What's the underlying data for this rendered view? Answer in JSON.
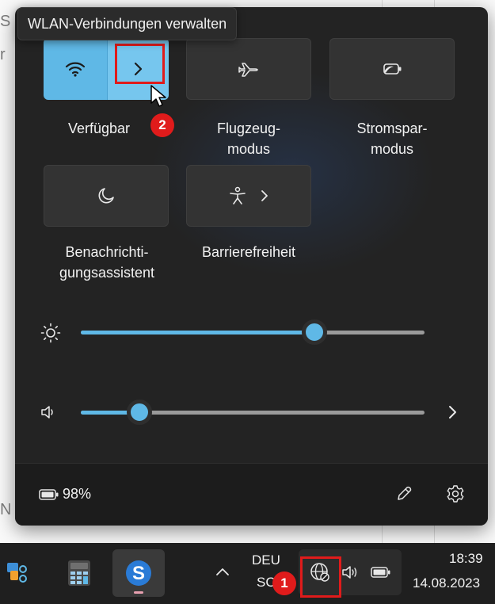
{
  "tooltip": {
    "text": "WLAN-Verbindungen verwalten"
  },
  "tiles": {
    "wifi": {
      "label": "Verfügbar",
      "icon": "wifi-icon",
      "expand_icon": "chevron-right-icon"
    },
    "airplane": {
      "label": "Flugzeug-\nmodus",
      "icon": "airplane-icon"
    },
    "battery_saver": {
      "label": "Stromspar-\nmodus",
      "icon": "battery-saver-icon"
    },
    "focus": {
      "label": "Benachrichti-\ngungsassistent",
      "icon": "moon-icon"
    },
    "accessibility": {
      "label": "Barrierefreiheit",
      "icon": "accessibility-icon",
      "expand_icon": "chevron-right-icon"
    }
  },
  "sliders": {
    "brightness": {
      "icon": "brightness-icon",
      "value": 0.68
    },
    "volume": {
      "icon": "speaker-icon",
      "value": 0.17,
      "expand_icon": "chevron-right-icon"
    }
  },
  "footer": {
    "battery_text": "98%",
    "battery_icon": "battery-icon",
    "edit_icon": "pencil-icon",
    "settings_icon": "gear-icon"
  },
  "annotations": {
    "step1": "1",
    "step2": "2",
    "color": "#e01b1b"
  },
  "taskbar": {
    "language_line1": "DEU",
    "language_line2": "SC",
    "time": "18:39",
    "date": "14.08.2023",
    "apps": [
      "snipping-tool-icon",
      "calculator-icon",
      "skype-icon"
    ],
    "tray": [
      "chevron-up-icon",
      "network-icon",
      "speaker-icon",
      "battery-icon"
    ]
  },
  "accent": "#5fb8e6"
}
